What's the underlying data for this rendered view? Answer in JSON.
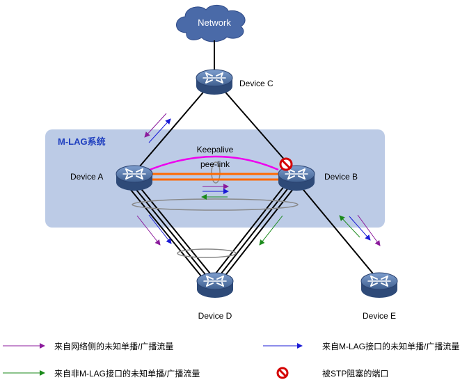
{
  "network": {
    "label": "Network"
  },
  "mlag_system": {
    "label": "M-LAG系统",
    "color": "#1f3fbf",
    "fill": "#bccbe6"
  },
  "devices": {
    "a": "Device A",
    "b": "Device B",
    "c": "Device C",
    "d": "Device D",
    "e": "Device E"
  },
  "links": {
    "keepalive": "Keepalive",
    "peer_link": "pee-link"
  },
  "legend": {
    "network_traffic": "来自网络侧的未知单播/广播流量",
    "mlag_traffic": "来自M-LAG接口的未知单播/广播流量",
    "non_mlag_traffic": "来自非M-LAG接口的未知单播/广播流量",
    "stp_blocked": "被STP阻塞的端口"
  },
  "colors": {
    "network_traffic": "#8b1a9c",
    "mlag_traffic": "#1a1ad6",
    "non_mlag_traffic": "#1a8a1a",
    "blocked": "#d40000",
    "keepalive": "#ee00ee",
    "peer_link": "#ff6a00",
    "device": "#4a6a9a"
  }
}
